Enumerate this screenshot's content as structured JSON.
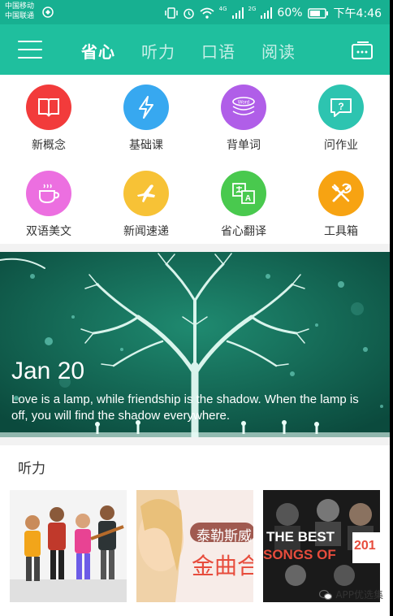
{
  "status": {
    "carrier1": "中国移动",
    "carrier2": "中国联通",
    "battery": "60%",
    "time": "下午4:46",
    "net1": "4G",
    "net2": "2G"
  },
  "header": {
    "tabs": [
      {
        "label": "省心",
        "active": true
      },
      {
        "label": "听力",
        "active": false
      },
      {
        "label": "口语",
        "active": false
      },
      {
        "label": "阅读",
        "active": false
      }
    ]
  },
  "grid": {
    "items": [
      {
        "label": "新概念",
        "color": "#f23b3b",
        "icon": "book-icon"
      },
      {
        "label": "基础课",
        "color": "#37a8f0",
        "icon": "lightning-icon"
      },
      {
        "label": "背单词",
        "color": "#b05ee8",
        "icon": "word-stack-icon",
        "icon_text": "Word"
      },
      {
        "label": "问作业",
        "color": "#2dc4b0",
        "icon": "question-bubble-icon",
        "icon_text": "?"
      },
      {
        "label": "双语美文",
        "color": "#ec6fe0",
        "icon": "coffee-cup-icon"
      },
      {
        "label": "新闻速递",
        "color": "#f7c236",
        "icon": "airplane-icon"
      },
      {
        "label": "省心翻译",
        "color": "#49c94e",
        "icon": "translate-icon",
        "icon_text": "A"
      },
      {
        "label": "工具箱",
        "color": "#f7a312",
        "icon": "tools-icon"
      }
    ]
  },
  "banner": {
    "date": "Jan 20",
    "quote": "Love is a lamp, while friendship is the shadow. When the lamp is off, you will find the shadow everywhere."
  },
  "listening": {
    "title": "听力",
    "cards": [
      {
        "name": "band-photo-card"
      },
      {
        "name": "taylor-swift-card",
        "text1": "泰勒斯威",
        "text2": "金曲合"
      },
      {
        "name": "best-songs-card",
        "text1": "THE BEST",
        "text2": "SONGS OF",
        "text3": "201"
      }
    ]
  },
  "watermark": "APP优选集"
}
